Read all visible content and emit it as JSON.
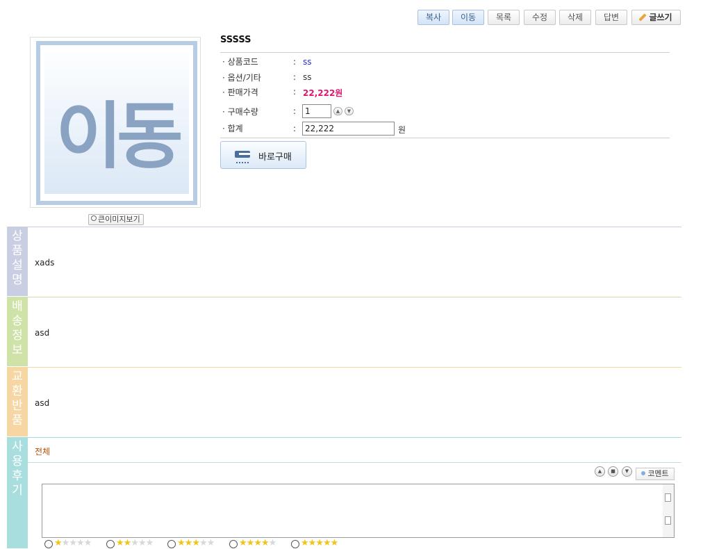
{
  "toolbar": {
    "copy": "복사",
    "move": "이동",
    "list": "목록",
    "edit": "수정",
    "delete": "삭제",
    "reply": "답변",
    "write": "글쓰기"
  },
  "product": {
    "image_text": "이동",
    "big_image_label": "큰이미지보기",
    "title": "SSSSS",
    "code_label": "상품코드",
    "code_value": "ss",
    "option_label": "옵션/기타",
    "option_value": "ss",
    "price_label": "판매가격",
    "price_value": "22,222원",
    "qty_label": "구매수량",
    "qty_value": "1",
    "total_label": "합계",
    "total_value": "22,222",
    "total_unit": "원",
    "buy_now": "바로구매",
    "colon": ":"
  },
  "sections": {
    "description": {
      "tab": [
        "상",
        "품",
        "설",
        "명"
      ],
      "content": "xads",
      "color": "#c9cee3"
    },
    "shipping": {
      "tab": [
        "배",
        "송",
        "정",
        "보"
      ],
      "content": "asd",
      "color": "#cfe2a8"
    },
    "returns": {
      "tab": [
        "교",
        "환",
        "반",
        "품"
      ],
      "content": "asd",
      "color": "#f6d7a3"
    },
    "reviews": {
      "tab": [
        "사",
        "용",
        "후",
        "기"
      ],
      "color": "#a9dedf"
    }
  },
  "reviews": {
    "filter_all": "전체",
    "comment_button": "코멘트",
    "ratings": [
      1,
      2,
      3,
      4,
      5
    ]
  }
}
